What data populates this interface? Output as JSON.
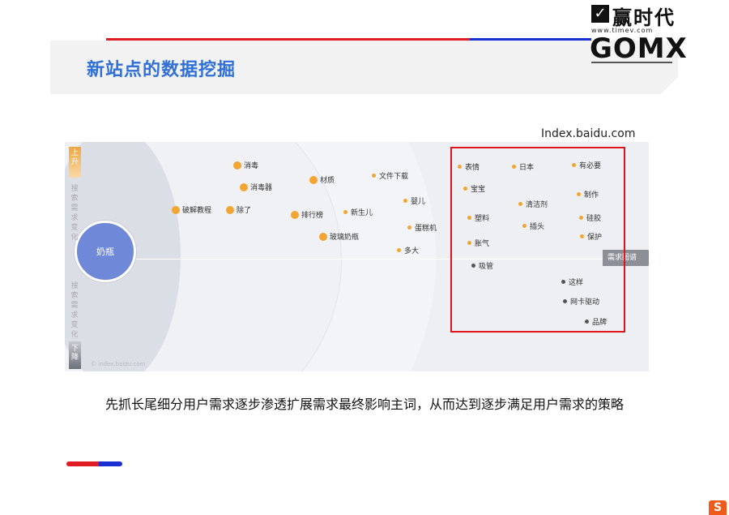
{
  "header": {
    "title": "新站点的数据挖掘",
    "logo_check": "✓",
    "logo_cn": "赢时代",
    "logo_url": "www.timev.com",
    "logo_en": "GOMX",
    "colors": {
      "accent_red": "#e01c24",
      "accent_blue": "#1a2fd0",
      "title_blue": "#2f6fd6"
    }
  },
  "diagram": {
    "source": "Index.baidu.com",
    "center": "奶瓶",
    "up_label": "上升",
    "down_label": "下降",
    "side_top": "搜索需求变化",
    "side_bottom": "搜索需求变化",
    "axis_label": "需求图谱",
    "watermark": "© index.baidu.com",
    "inner_nodes": [
      "消毒",
      "消毒器",
      "破解教程",
      "除了",
      "材质",
      "排行榜",
      "玻璃奶瓶",
      "文件下载",
      "新生儿",
      "婴儿",
      "蛋糕机",
      "多大"
    ],
    "outer_nodes": [
      "表情",
      "日本",
      "有必要",
      "宝宝",
      "清洁剂",
      "制作",
      "塑料",
      "插头",
      "硅胶",
      "胀气",
      "保护",
      "吸管"
    ],
    "outer_dark_nodes": [
      "这样",
      "网卡驱动",
      "品牌"
    ],
    "colors": {
      "node": "#f3a531",
      "center": "#6f89d8",
      "highlight": "#e0141b"
    }
  },
  "caption": "先抓长尾细分用户需求逐步渗透扩展需求最终影响主词，从而达到逐步满足用户需求的策略",
  "footer": {
    "corner_logo": "S"
  }
}
